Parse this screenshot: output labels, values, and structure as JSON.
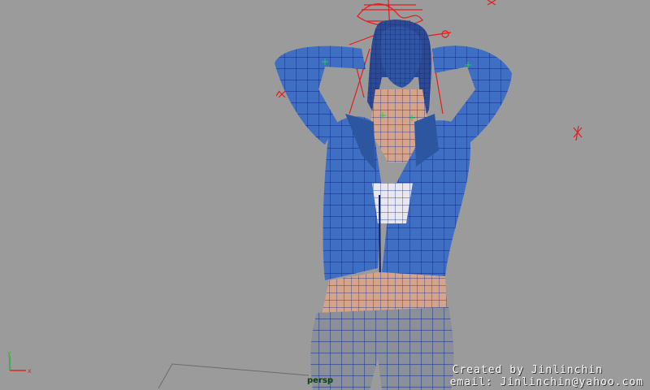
{
  "viewport": {
    "camera_label": "persp",
    "background": "#9b9b9b"
  },
  "credits": {
    "line1": "Created by Jinlinchin",
    "line2": "email: Jinlinchin@yahoo.com"
  },
  "axis": {
    "x_label": "x",
    "y_label": "y",
    "x_color": "#d42a2a",
    "y_color": "#2fae3c"
  },
  "colors": {
    "jacket": "#3e6fc3",
    "jacket_dark": "#2d56a0",
    "skin": "#d5a48c",
    "jeans": "#8a8f98",
    "wire": "#0a2a8a",
    "rig": "#e81a1a",
    "hair": "#2c4a94"
  }
}
